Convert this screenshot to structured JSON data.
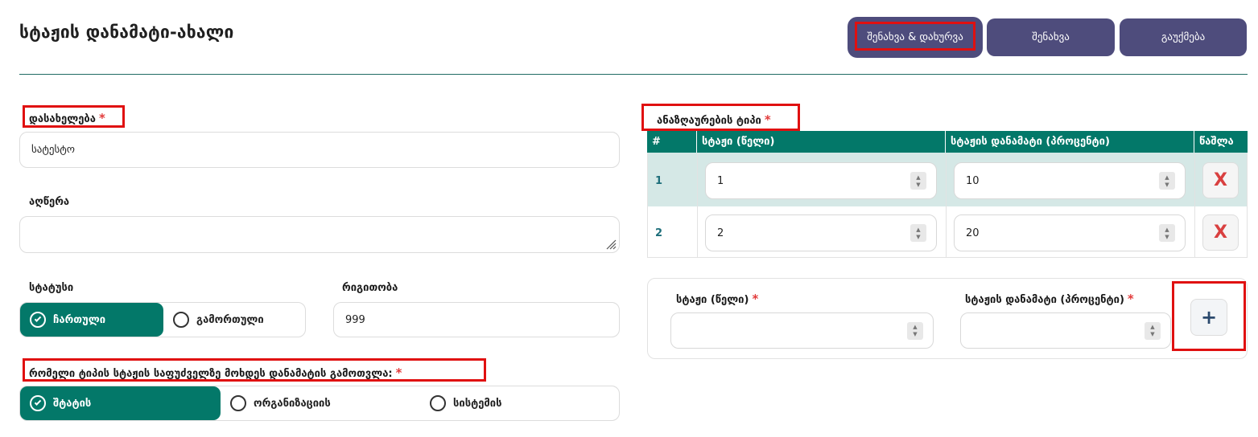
{
  "header": {
    "title": "სტაჟის დანამატი-ახალი",
    "buttons": {
      "save_close": "შენახვა & დახურვა",
      "save": "შენახვა",
      "cancel": "გაუქმება"
    }
  },
  "form": {
    "name": {
      "label": "დასახელება",
      "value": "სატესტო",
      "required_mark": "*"
    },
    "description": {
      "label": "აღწერა",
      "value": ""
    },
    "status": {
      "label": "სტატუსი",
      "options": [
        "ჩართული",
        "გამორთული"
      ],
      "selected": "ჩართული"
    },
    "order": {
      "label": "რიგითობა",
      "value": "999"
    },
    "calc_basis": {
      "label": "რომელი ტიპის სტაჟის საფუძველზე მოხდეს დანამატის გამოთვლა:",
      "required_mark": "*",
      "options": [
        "შტატის",
        "ორგანიზაციის",
        "სისტემის"
      ],
      "selected": "შტატის"
    }
  },
  "calc_type": {
    "label": "ანაზღაურების ტიპი",
    "required_mark": "*",
    "table": {
      "headers": [
        "#",
        "სტაჟი (წელი)",
        "სტაჟის დანამატი (პროცენტი)",
        "წაშლა"
      ],
      "rows": [
        {
          "num": "1",
          "years": "1",
          "percent": "10",
          "delete": "X"
        },
        {
          "num": "2",
          "years": "2",
          "percent": "20",
          "delete": "X"
        }
      ]
    },
    "new_row": {
      "years_label": "სტაჟი (წელი)",
      "percent_label": "სტაჟის დანამატი (პროცენტი)",
      "required_mark": "*",
      "add_label": "+"
    }
  },
  "colors": {
    "accent": "#037869",
    "button": "#4e4c7c",
    "highlight": "#e01010",
    "required": "#e23b3b"
  },
  "icons": {
    "spinner": "spinner-icon",
    "check": "check-icon",
    "resize": "resize-grip-icon"
  }
}
